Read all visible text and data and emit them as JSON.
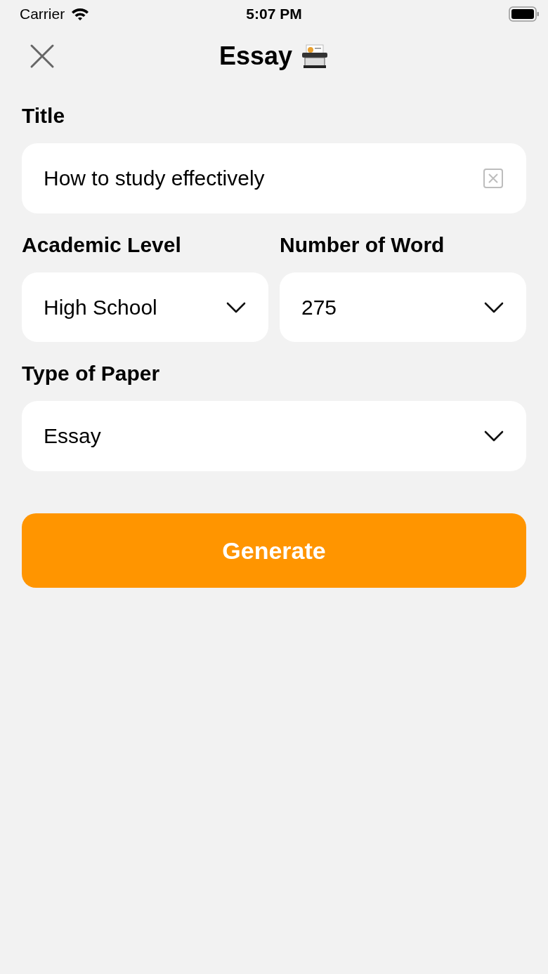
{
  "status_bar": {
    "carrier": "Carrier",
    "time": "5:07 PM"
  },
  "nav": {
    "title": "Essay"
  },
  "fields": [
    {
      "label": "Title",
      "kind": "text",
      "value": "How to study effectively"
    },
    {
      "label": "Academic Level",
      "kind": "select",
      "value": "High School"
    },
    {
      "label": "Number of Word",
      "kind": "select",
      "value": "275"
    },
    {
      "label": "Type of Paper",
      "kind": "select",
      "value": "Essay"
    }
  ],
  "button": {
    "label": "Generate"
  }
}
